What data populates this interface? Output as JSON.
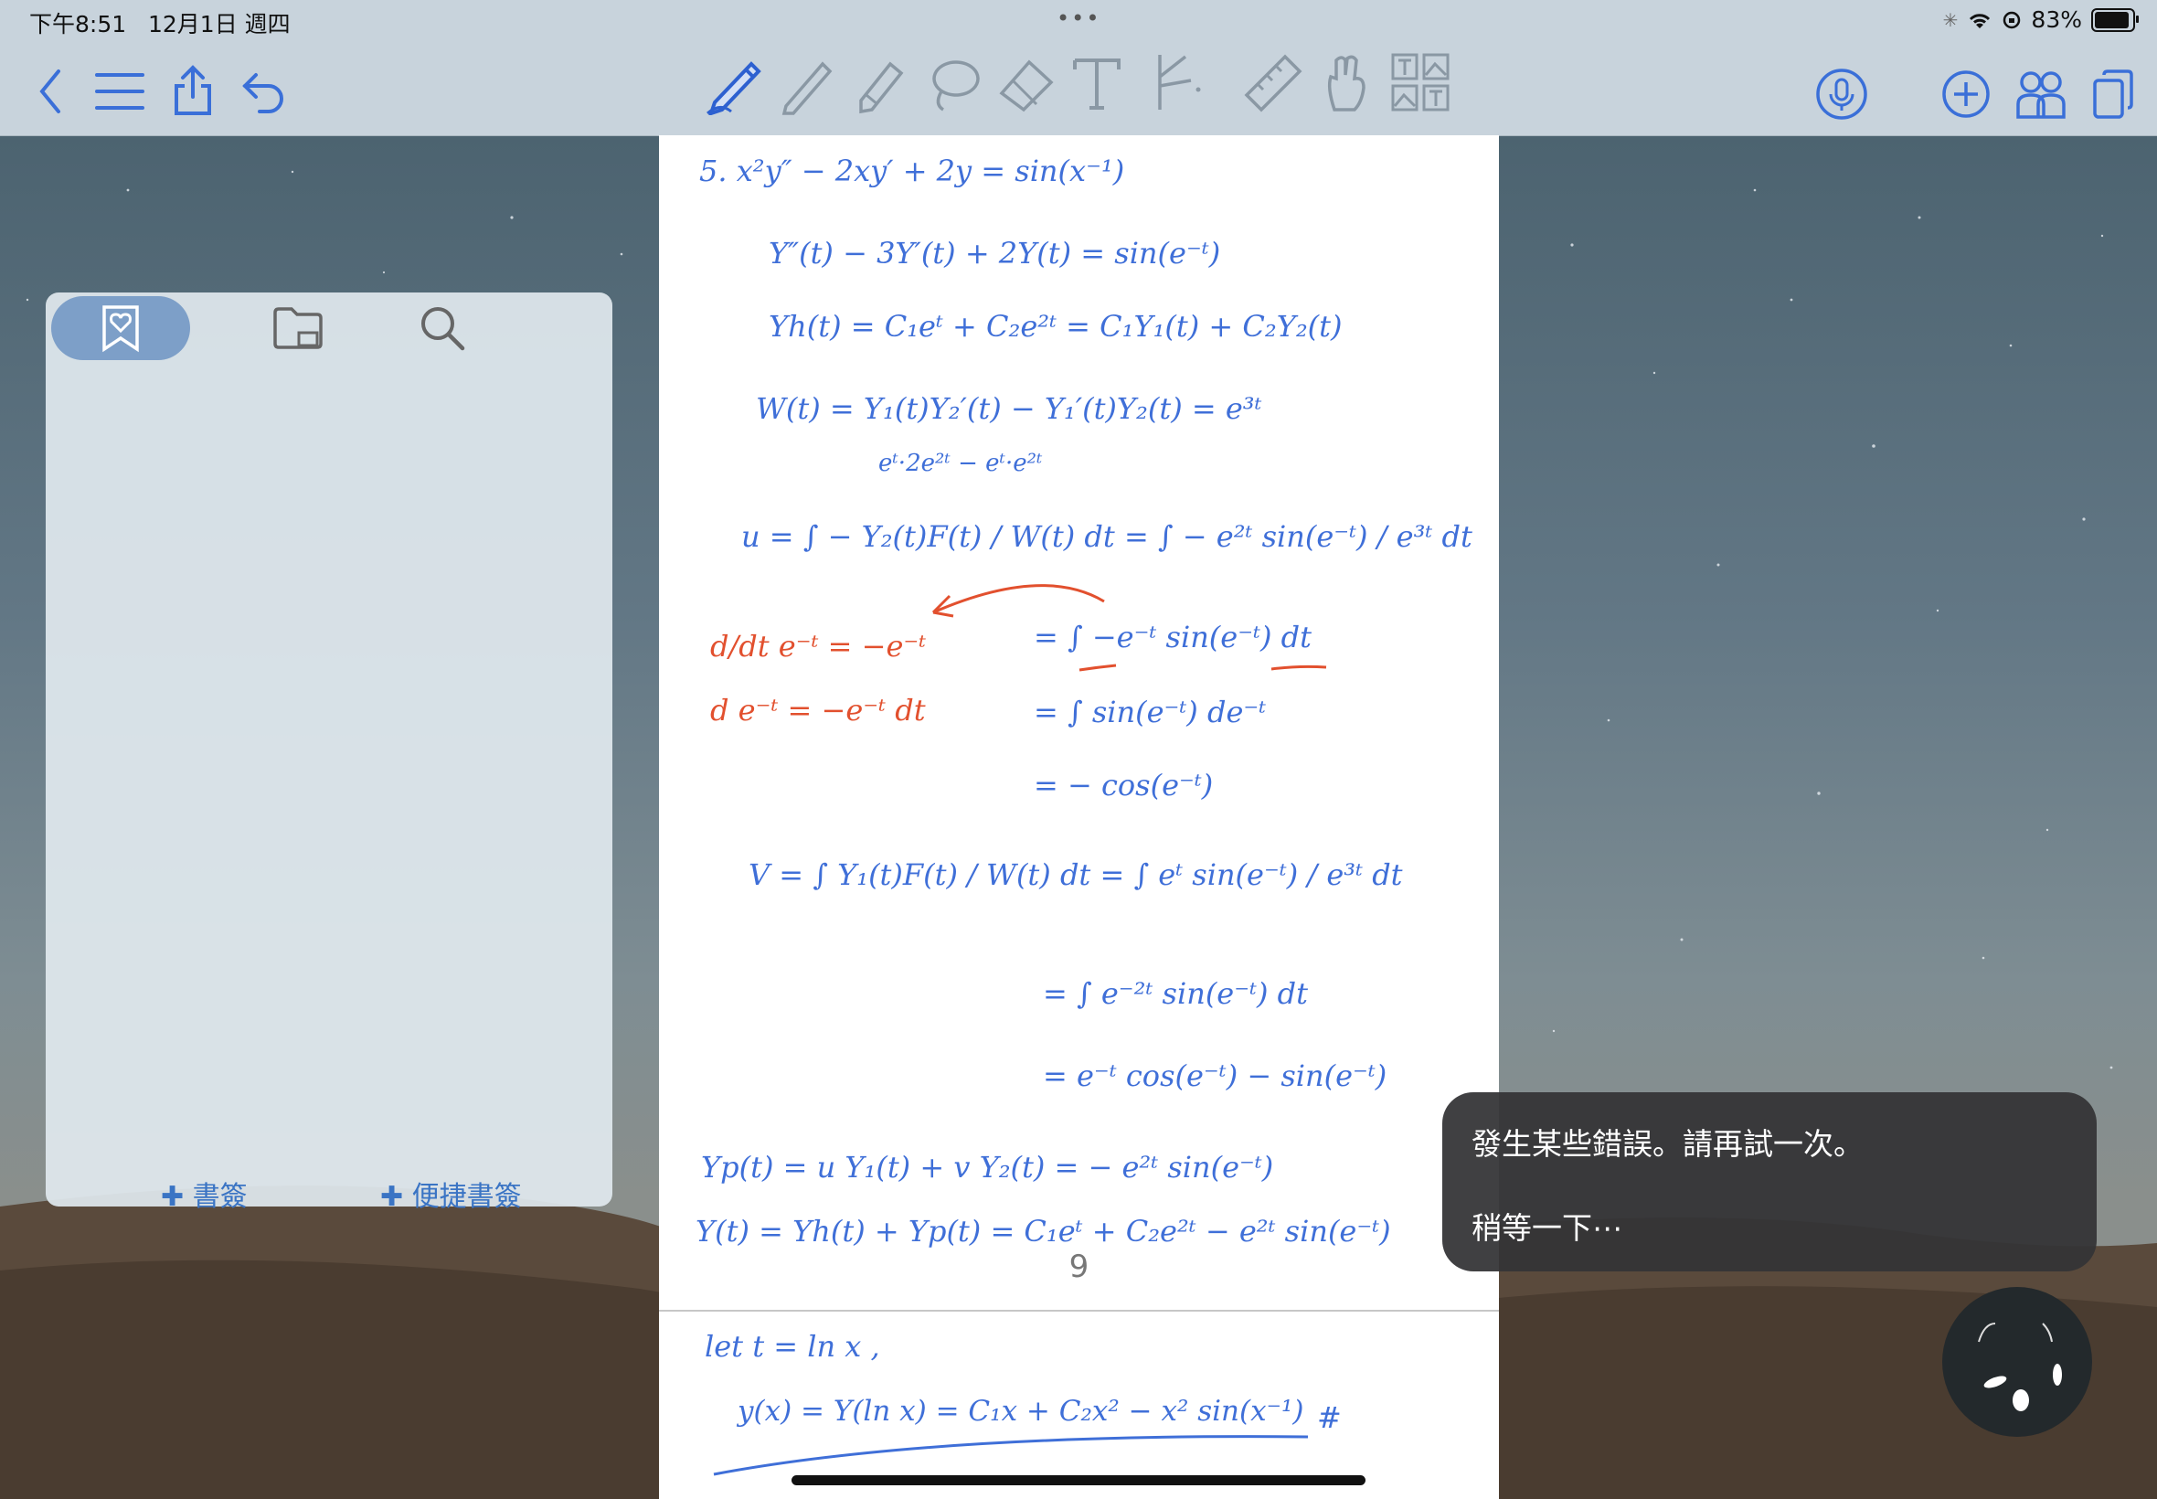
{
  "status_bar": {
    "time": "下午8:51",
    "date": "12月1日 週四",
    "battery": "83%",
    "battery_level": 0.83
  },
  "toolbar": {
    "left_icons": [
      "back-icon",
      "menu-icon",
      "share-icon",
      "undo-icon"
    ],
    "tools": [
      "pen-icon",
      "pencil-icon",
      "highlighter-icon",
      "lasso-icon",
      "eraser-icon",
      "text-tool-icon",
      "element-tool-icon",
      "ruler-icon",
      "hand-icon",
      "image-text-icon"
    ],
    "right_icons": [
      "microphone-icon",
      "add-icon",
      "collaborate-icon",
      "pages-icon"
    ],
    "accent_color": "#3a6fd8"
  },
  "sidebar": {
    "tabs": [
      "bookmark-icon",
      "folder-icon",
      "search-icon"
    ],
    "active_tab": 0,
    "add_bookmark": "✚ 書簽",
    "add_quick_bookmark": "✚ 便捷書簽"
  },
  "document": {
    "page_number": "9",
    "lines": [
      "5.     x²y″ − 2xy′ + 2y = sin(x⁻¹)",
      "Y″(t) − 3Y′(t) + 2Y(t) = sin(e⁻ᵗ)",
      "Yh(t) = C₁eᵗ + C₂e²ᵗ  =  C₁Y₁(t) + C₂Y₂(t)",
      "W(t) = Y₁(t)Y₂′(t) − Y₁′(t)Y₂(t) = e³ᵗ",
      "eᵗ·2e²ᵗ  −  eᵗ·e²ᵗ",
      "u = ∫ − Y₂(t)F(t) / W(t) dt  =  ∫ − e²ᵗ sin(e⁻ᵗ) / e³ᵗ dt",
      "=  ∫ −e⁻ᵗ sin(e⁻ᵗ) dt",
      "= ∫ sin(e⁻ᵗ) de⁻ᵗ",
      "=  − cos(e⁻ᵗ)",
      "V = ∫ Y₁(t)F(t) / W(t) dt  =  ∫ eᵗ sin(e⁻ᵗ) / e³ᵗ dt",
      "= ∫ e⁻²ᵗ sin(e⁻ᵗ) dt",
      "=  e⁻ᵗ cos(e⁻ᵗ) − sin(e⁻ᵗ)",
      "Yp(t) = u Y₁(t) +  v Y₂(t)  =  − e²ᵗ sin(e⁻ᵗ)",
      "Y(t) = Yh(t) + Yp(t) = C₁eᵗ + C₂e²ᵗ − e²ᵗ sin(e⁻ᵗ)"
    ],
    "red_notes": [
      "d/dt e⁻ᵗ = −e⁻ᵗ",
      "d e⁻ᵗ = −e⁻ᵗ dt"
    ],
    "next_page_lines": [
      "let   t = ln x ,",
      "y(x) = Y(ln x) = C₁x + C₂x² − x² sin(x⁻¹)",
      "#"
    ],
    "ink_blue": "#3f6fd8",
    "ink_red": "#e2502e"
  },
  "toast": {
    "message": "發生某些錯誤。請再試一次。",
    "hint": "稍等一下⋯"
  }
}
